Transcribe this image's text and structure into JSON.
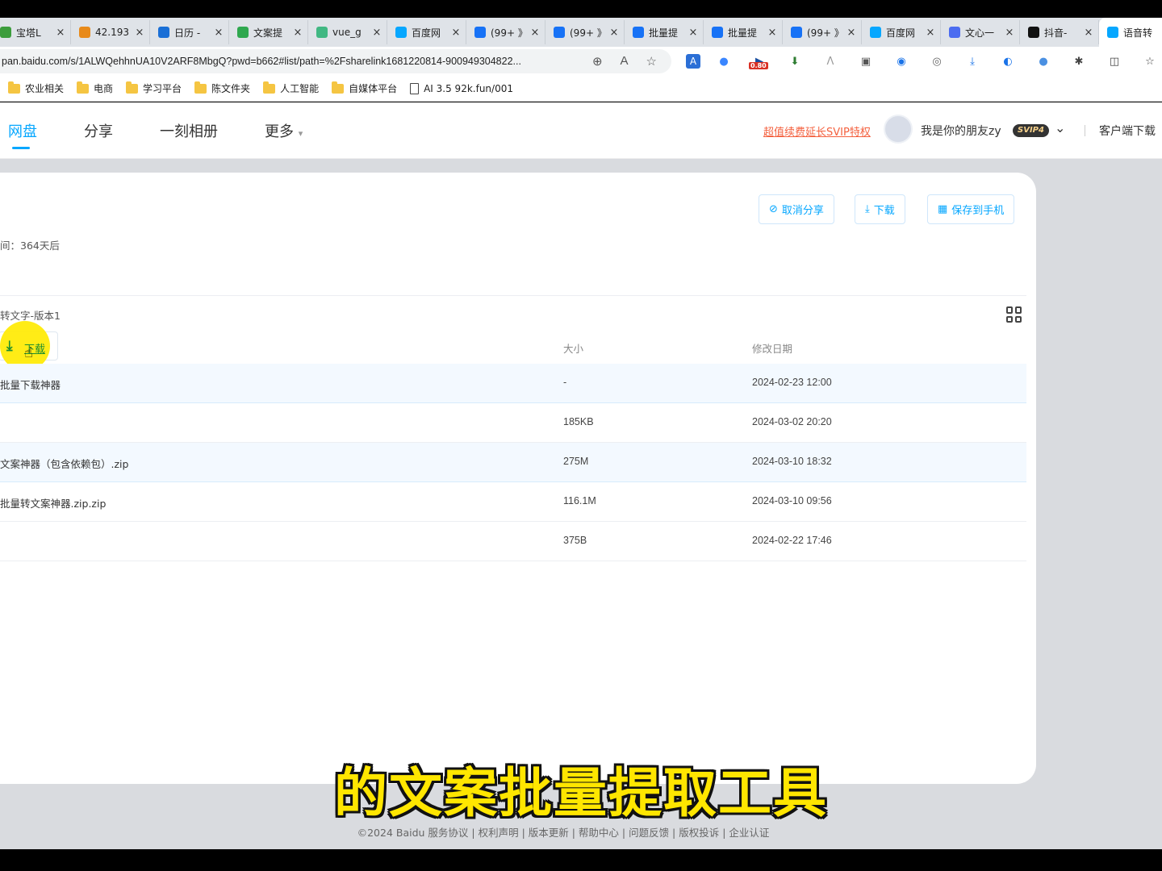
{
  "tabs": [
    {
      "label": "宝塔L",
      "color": "#3c9d3c"
    },
    {
      "label": "42.193",
      "color": "#e88a1a"
    },
    {
      "label": "日历 -",
      "color": "#1a6fd6"
    },
    {
      "label": "文案提",
      "color": "#2fa84f"
    },
    {
      "label": "vue_g",
      "color": "#41b883"
    },
    {
      "label": "百度网",
      "color": "#06a7ff"
    },
    {
      "label": "(99+ 》",
      "color": "#1772f6"
    },
    {
      "label": "(99+ 》",
      "color": "#1772f6"
    },
    {
      "label": "批量提",
      "color": "#1772f6"
    },
    {
      "label": "批量提",
      "color": "#1772f6"
    },
    {
      "label": "(99+ 》",
      "color": "#1772f6"
    },
    {
      "label": "百度网",
      "color": "#06a7ff"
    },
    {
      "label": "文心一",
      "color": "#4b6cf0"
    },
    {
      "label": "抖音-",
      "color": "#111111"
    },
    {
      "label": "语音转",
      "color": "#06a7ff"
    }
  ],
  "address": {
    "url": "pan.baidu.com/s/1ALWQehhnUA10V2ARF8MbgQ?pwd=b662#list/path=%2Fsharelink1681220814-900949304822...",
    "ext_badge": "0.80"
  },
  "bookmarks": [
    "农业相关",
    "电商",
    "学习平台",
    "陈文件夹",
    "人工智能",
    "自媒体平台",
    "AI 3.5  92k.fun/001"
  ],
  "header": {
    "nav": [
      "网盘",
      "分享",
      "一刻相册",
      "更多"
    ],
    "promo": "超值续费延长SVIP特权",
    "username": "我是你的朋友zy",
    "vip_badge": "SVIP4",
    "client": "客户端下载"
  },
  "share": {
    "cancel_share": "取消分享",
    "download": "下载",
    "save_to_phone": "保存到手机",
    "expire": "间：364天后",
    "breadcrumb": "转文字-版本1",
    "row_download": "下载"
  },
  "table": {
    "columns": [
      "大小",
      "修改日期"
    ],
    "rows": [
      {
        "name": "批量下载神器",
        "size": "-",
        "date": "2024-02-23 12:00",
        "selected": true
      },
      {
        "name": "",
        "size": "185KB",
        "date": "2024-03-02 20:20",
        "selected": false
      },
      {
        "name": "文案神器（包含依赖包）.zip",
        "size": "275M",
        "date": "2024-03-10 18:32",
        "selected": true
      },
      {
        "name": "批量转文案神器.zip.zip",
        "size": "116.1M",
        "date": "2024-03-10 09:56",
        "selected": false
      },
      {
        "name": "",
        "size": "375B",
        "date": "2024-02-22 17:46",
        "selected": false
      }
    ]
  },
  "subtitle": "的文案批量提取工具",
  "footer": "©2024 Baidu  服务协议 | 权利声明 | 版本更新 | 帮助中心 | 问题反馈 | 版权投诉 | 企业认证"
}
